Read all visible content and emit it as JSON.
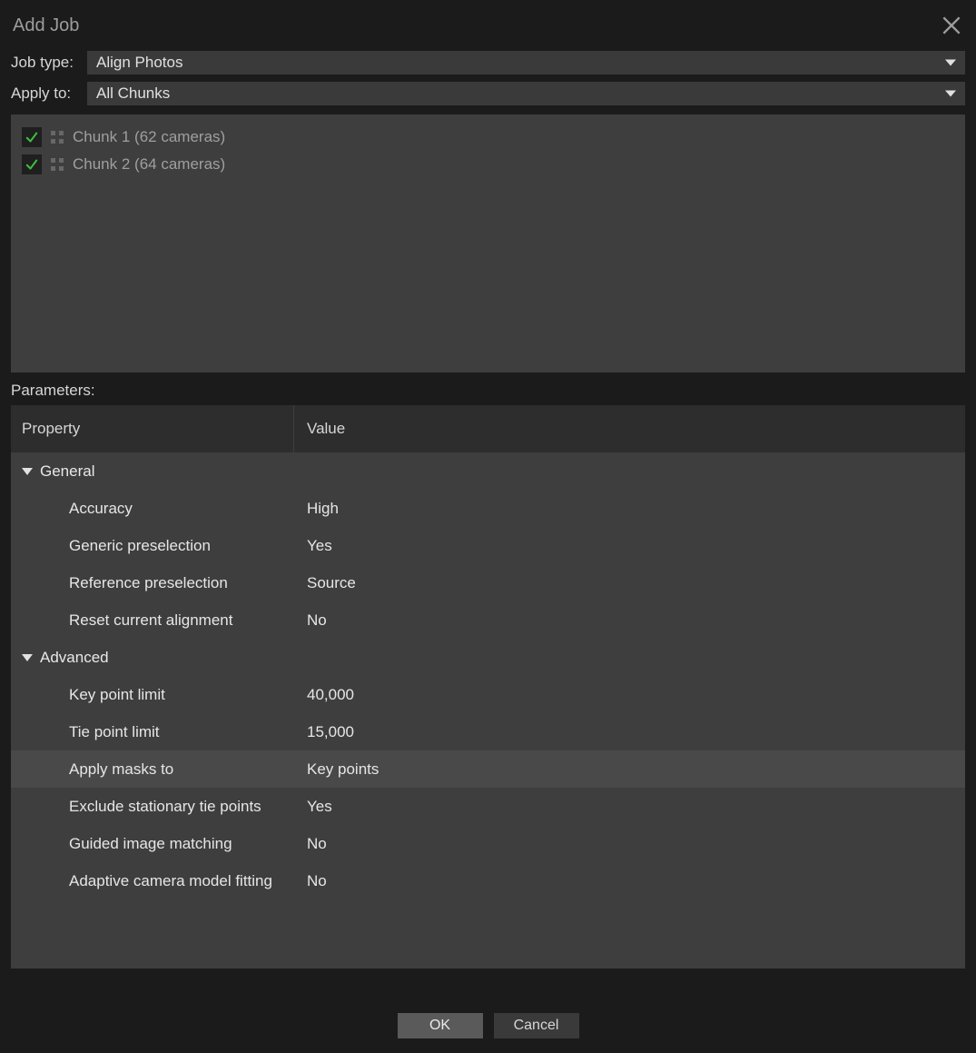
{
  "title": "Add Job",
  "form": {
    "job_type_label": "Job type:",
    "job_type_value": "Align Photos",
    "apply_to_label": "Apply to:",
    "apply_to_value": "All Chunks"
  },
  "chunks": [
    {
      "label": "Chunk 1 (62 cameras)",
      "checked": true
    },
    {
      "label": "Chunk 2 (64 cameras)",
      "checked": true
    }
  ],
  "parameters_label": "Parameters:",
  "columns": {
    "property": "Property",
    "value": "Value"
  },
  "groups": [
    {
      "name": "General",
      "rows": [
        {
          "name": "Accuracy",
          "value": "High"
        },
        {
          "name": "Generic preselection",
          "value": "Yes"
        },
        {
          "name": "Reference preselection",
          "value": "Source"
        },
        {
          "name": "Reset current alignment",
          "value": "No"
        }
      ]
    },
    {
      "name": "Advanced",
      "rows": [
        {
          "name": "Key point limit",
          "value": "40,000"
        },
        {
          "name": "Tie point limit",
          "value": "15,000"
        },
        {
          "name": "Apply masks to",
          "value": "Key points",
          "selected": true
        },
        {
          "name": "Exclude stationary tie points",
          "value": "Yes"
        },
        {
          "name": "Guided image matching",
          "value": "No"
        },
        {
          "name": "Adaptive camera model fitting",
          "value": "No"
        }
      ]
    }
  ],
  "buttons": {
    "ok": "OK",
    "cancel": "Cancel"
  }
}
